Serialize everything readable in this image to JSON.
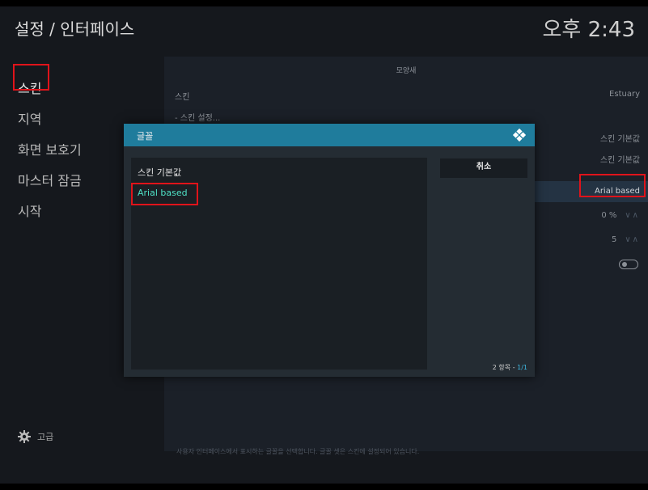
{
  "header": {
    "title": "설정 / 인터페이스",
    "clock": "오후 2:43"
  },
  "sidebar": {
    "items": [
      {
        "label": "스킨"
      },
      {
        "label": "지역"
      },
      {
        "label": "화면 보호기"
      },
      {
        "label": "마스터 잠금"
      },
      {
        "label": "시작"
      }
    ],
    "level_label": "고급"
  },
  "main": {
    "section_title": "모양새",
    "rows": [
      {
        "label": "스킨",
        "value": "Estuary"
      },
      {
        "label": "- 스킨 설정...",
        "value": ""
      },
      {
        "label": "",
        "value": "스킨 기본값"
      },
      {
        "label": "",
        "value": "스킨 기본값"
      },
      {
        "label": "",
        "value": "Arial based"
      },
      {
        "label": "",
        "value": "0 %"
      },
      {
        "label": "",
        "value": "5"
      }
    ],
    "footer": "사용자 인터페이스에서 표시하는 글꼴을 선택합니다. 글꼴 셋은 스킨에 설정되어 있습니다."
  },
  "dialog": {
    "title": "글꼴",
    "items": [
      "스킨 기본값",
      "Arial based"
    ],
    "cancel_label": "취소",
    "count_label": "2 항목 - ",
    "page_label": "1/1"
  },
  "colors": {
    "accent": "#1f7c9c",
    "selected_text": "#4fe2c6",
    "highlight": "#e0131a"
  }
}
